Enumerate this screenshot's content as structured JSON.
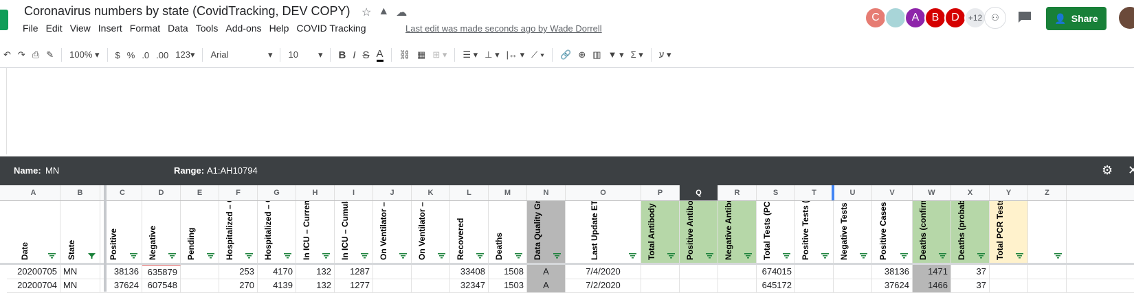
{
  "doc": {
    "title": "Coronavirus numbers by state (CovidTracking, DEV COPY)",
    "last_edit": "Last edit was made seconds ago by Wade Dorrell",
    "menu": [
      "File",
      "Edit",
      "View",
      "Insert",
      "Format",
      "Data",
      "Tools",
      "Add-ons",
      "Help",
      "COVID Tracking"
    ],
    "share_label": "Share",
    "collaborators": [
      {
        "initial": "C",
        "color": "#e67c73"
      },
      {
        "initial": "",
        "color": "#a8d5d8"
      },
      {
        "initial": "A",
        "color": "#8e24aa"
      },
      {
        "initial": "B",
        "color": "#d50000"
      },
      {
        "initial": "D",
        "color": "#d50000"
      }
    ],
    "more_collaborators": "+12"
  },
  "toolbar": {
    "zoom": "100%",
    "currency": "$",
    "percent": "%",
    "dec_less": ".0",
    "dec_more": ".00",
    "format_more": "123",
    "font": "Arial",
    "font_size": "10",
    "bold": "B",
    "italic": "I",
    "strike": "S",
    "text_color": "A"
  },
  "range_bar": {
    "name_label": "Name:",
    "name_value": "MN",
    "range_label": "Range:",
    "range_value": "A1:AH10794"
  },
  "columns": [
    {
      "letter": "A",
      "header": "Date",
      "w": 78,
      "bg": ""
    },
    {
      "letter": "B",
      "header": "State",
      "w": 58,
      "bg": ""
    },
    {
      "letter": "C",
      "header": "Positive",
      "w": 57,
      "bg": ""
    },
    {
      "letter": "D",
      "header": "Negative",
      "w": 56,
      "bg": ""
    },
    {
      "letter": "E",
      "header": "Pending",
      "w": 56,
      "bg": ""
    },
    {
      "letter": "F",
      "header": "Hospitalized – Currently",
      "w": 56,
      "bg": ""
    },
    {
      "letter": "G",
      "header": "Hospitalized – Cumulative",
      "w": 56,
      "bg": ""
    },
    {
      "letter": "H",
      "header": "In ICU – Currently",
      "w": 56,
      "bg": ""
    },
    {
      "letter": "I",
      "header": "In ICU – Cumulative",
      "w": 56,
      "bg": ""
    },
    {
      "letter": "J",
      "header": "On Ventilator – Currently",
      "w": 56,
      "bg": ""
    },
    {
      "letter": "K",
      "header": "On Ventilator – Cumulative",
      "w": 56,
      "bg": ""
    },
    {
      "letter": "L",
      "header": "Recovered",
      "w": 56,
      "bg": ""
    },
    {
      "letter": "M",
      "header": "Deaths",
      "w": 56,
      "bg": ""
    },
    {
      "letter": "N",
      "header": "Data Quality Grade",
      "w": 56,
      "bg": "grey"
    },
    {
      "letter": "O",
      "header": "Last Update ET",
      "w": 110,
      "bg": ""
    },
    {
      "letter": "P",
      "header": "Total Antibody Tests (People)",
      "w": 56,
      "bg": "green"
    },
    {
      "letter": "Q",
      "header": "Positive Antibody Tests (People)",
      "w": 56,
      "bg": "green"
    },
    {
      "letter": "R",
      "header": "Negative Antibody Tests (People)",
      "w": 56,
      "bg": "green"
    },
    {
      "letter": "S",
      "header": "Total Tests (PCR)",
      "w": 56,
      "bg": ""
    },
    {
      "letter": "T",
      "header": "Positive Tests (PCR)",
      "w": 56,
      "bg": ""
    },
    {
      "letter": "U",
      "header": "Negative Tests (PCR)",
      "w": 56,
      "bg": ""
    },
    {
      "letter": "V",
      "header": "Positive Cases (PCR)",
      "w": 59,
      "bg": ""
    },
    {
      "letter": "W",
      "header": "Deaths (confirmed)",
      "w": 56,
      "bg": "green"
    },
    {
      "letter": "X",
      "header": "Deaths (probable)",
      "w": 56,
      "bg": "green"
    },
    {
      "letter": "Y",
      "header": "Total PCR Tests (People)",
      "w": 56,
      "bg": "yellow"
    },
    {
      "letter": "Z",
      "header": "",
      "w": 56,
      "bg": ""
    }
  ],
  "rows": [
    [
      "20200705",
      "MN",
      "38136",
      "635879",
      "",
      "253",
      "4170",
      "132",
      "1287",
      "",
      "",
      "33408",
      "1508",
      "A",
      "7/4/2020",
      "",
      "",
      "",
      "674015",
      "",
      "",
      "38136",
      "1471",
      "37",
      "",
      ""
    ],
    [
      "20200704",
      "MN",
      "37624",
      "607548",
      "",
      "270",
      "4139",
      "132",
      "1277",
      "",
      "",
      "32347",
      "1503",
      "A",
      "7/2/2020",
      "",
      "",
      "",
      "645172",
      "",
      "",
      "37624",
      "1466",
      "37",
      "",
      ""
    ]
  ]
}
